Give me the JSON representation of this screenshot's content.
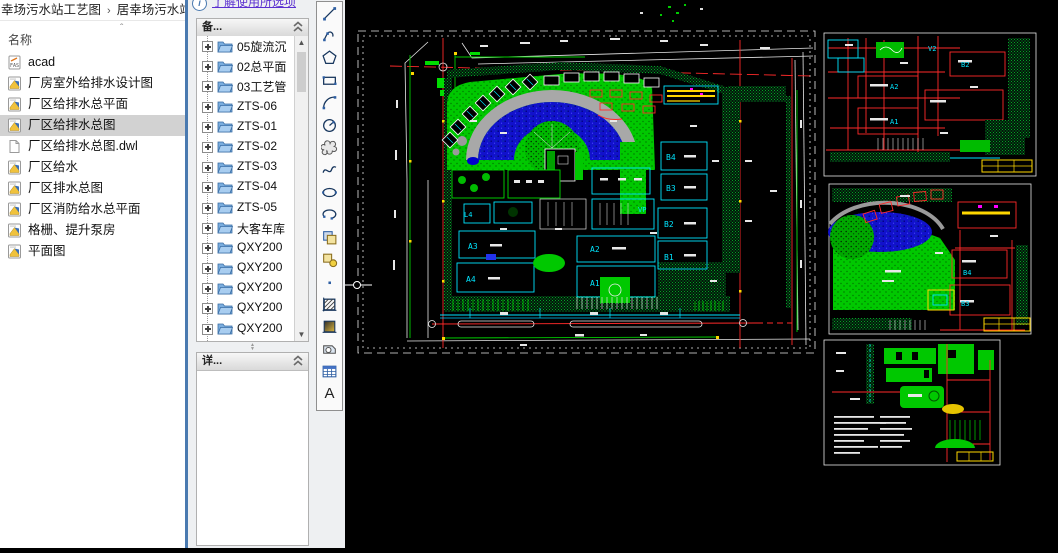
{
  "explorer": {
    "breadcrumb": {
      "part1": "幸场污水站工艺图",
      "separator": "›",
      "part2": "居幸场污水站"
    },
    "columns": {
      "name": "名称",
      "sort_glyph": "ˆ"
    },
    "files": [
      {
        "name": "acad",
        "type": "fas-file-icon"
      },
      {
        "name": "厂房室外给排水设计图",
        "type": "dwg-file-icon"
      },
      {
        "name": "厂区给排水总平面",
        "type": "dwg-file-icon"
      },
      {
        "name": "厂区给排水总图",
        "type": "dwg-file-icon",
        "selected": true
      },
      {
        "name": "厂区给排水总图.dwl",
        "type": "plain-file-icon"
      },
      {
        "name": "厂区给水",
        "type": "dwg-file-icon"
      },
      {
        "name": "厂区排水总图",
        "type": "dwg-file-icon"
      },
      {
        "name": "厂区消防给水总平面",
        "type": "dwg-file-icon"
      },
      {
        "name": "格栅、提升泵房",
        "type": "dwg-file-icon"
      },
      {
        "name": "平面图",
        "type": "dwg-file-icon"
      }
    ]
  },
  "sidebar": {
    "help_link": "了解使用所选项",
    "backup_panel_title": "备...",
    "details_panel_title": "详...",
    "tree_items": [
      "05旋流沉",
      "02总平面",
      "03工艺管",
      "ZTS-06",
      "ZTS-01",
      "ZTS-02",
      "ZTS-03",
      "ZTS-04",
      "ZTS-05",
      "大客车库",
      "QXY200",
      "QXY200",
      "QXY200",
      "QXY200",
      "QXY200"
    ]
  },
  "toolbar": {
    "tools": [
      "line",
      "polyline",
      "polygon",
      "rectangle",
      "arc",
      "circle",
      "revision-cloud",
      "spline",
      "ellipse",
      "ellipse-arc",
      "insert-block",
      "make-block",
      "point",
      "hatch",
      "gradient",
      "region",
      "table",
      "multiline-text"
    ],
    "mtext_label": "A"
  },
  "canvas": {
    "main_labels": {
      "a1": "A1",
      "a2": "A2",
      "a3": "A3",
      "a4": "A4",
      "b1": "B1",
      "b2": "B2",
      "b3": "B3",
      "b4": "B4",
      "vp": "VP",
      "l4": "L4"
    },
    "detail1_labels": {
      "v2": "V2",
      "b2": "B2",
      "a2": "A2",
      "a1": "A1"
    },
    "detail2_labels": {
      "b4": "B4",
      "b3": "B3"
    },
    "colors": {
      "background": "#000000",
      "site_green": "#00c800",
      "water_blue": "#1111cc",
      "axis_red": "#ff2a2a",
      "outline_cyan": "#00e5ff",
      "accent_yellow": "#ffd700"
    }
  }
}
